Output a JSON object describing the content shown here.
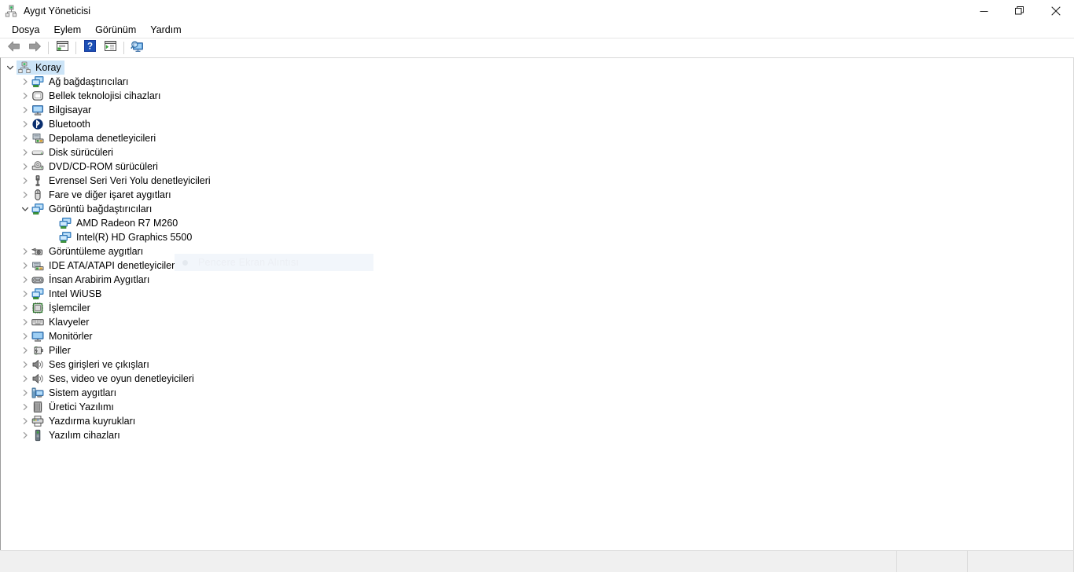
{
  "window": {
    "title": "Aygıt Yöneticisi",
    "icon": "device-manager-icon",
    "minimize_label": "—",
    "maximize_label": "❐",
    "close_label": "✕"
  },
  "menu": {
    "items": [
      {
        "label": "Dosya",
        "name": "menu-dosya"
      },
      {
        "label": "Eylem",
        "name": "menu-eylem"
      },
      {
        "label": "Görünüm",
        "name": "menu-gorunum"
      },
      {
        "label": "Yardım",
        "name": "menu-yardim"
      }
    ]
  },
  "toolbar": {
    "buttons": [
      {
        "name": "back-button",
        "icon": "back-arrow-icon"
      },
      {
        "name": "forward-button",
        "icon": "forward-arrow-icon"
      },
      {
        "name": "properties-button",
        "icon": "properties-window-icon"
      },
      {
        "name": "help-button",
        "icon": "help-question-icon"
      },
      {
        "name": "show-hidden-button",
        "icon": "window-play-icon"
      },
      {
        "name": "scan-hardware-button",
        "icon": "scan-monitor-icon"
      }
    ]
  },
  "tree": {
    "root": {
      "label": "Koray",
      "icon": "computer-root-icon",
      "expanded": true,
      "selected": true
    },
    "items": [
      {
        "label": "Ağ bağdaştırıcıları",
        "icon": "network-adapter-icon",
        "level": 1,
        "expanded": false
      },
      {
        "label": "Bellek teknolojisi cihazları",
        "icon": "memory-technology-icon",
        "level": 1,
        "expanded": false
      },
      {
        "label": "Bilgisayar",
        "icon": "computer-icon",
        "level": 1,
        "expanded": false
      },
      {
        "label": "Bluetooth",
        "icon": "bluetooth-icon",
        "level": 1,
        "expanded": false
      },
      {
        "label": "Depolama denetleyicileri",
        "icon": "storage-controller-icon",
        "level": 1,
        "expanded": false
      },
      {
        "label": "Disk sürücüleri",
        "icon": "disk-drive-icon",
        "level": 1,
        "expanded": false
      },
      {
        "label": "DVD/CD-ROM sürücüleri",
        "icon": "dvd-drive-icon",
        "level": 1,
        "expanded": false
      },
      {
        "label": "Evrensel Seri Veri Yolu denetleyicileri",
        "icon": "usb-controller-icon",
        "level": 1,
        "expanded": false
      },
      {
        "label": "Fare ve diğer işaret aygıtları",
        "icon": "mouse-icon",
        "level": 1,
        "expanded": false
      },
      {
        "label": "Görüntü bağdaştırıcıları",
        "icon": "display-adapter-icon",
        "level": 1,
        "expanded": true
      },
      {
        "label": "AMD Radeon R7 M260",
        "icon": "display-adapter-icon",
        "level": 2,
        "expanded": null
      },
      {
        "label": "Intel(R) HD Graphics 5500",
        "icon": "display-adapter-icon",
        "level": 2,
        "expanded": null
      },
      {
        "label": "Görüntüleme aygıtları",
        "icon": "imaging-device-icon",
        "level": 1,
        "expanded": false
      },
      {
        "label": "IDE ATA/ATAPI denetleyiciler",
        "icon": "ide-controller-icon",
        "level": 1,
        "expanded": false
      },
      {
        "label": "İnsan Arabirim Aygıtları",
        "icon": "human-interface-icon",
        "level": 1,
        "expanded": false
      },
      {
        "label": "Intel WiUSB",
        "icon": "network-adapter-icon",
        "level": 1,
        "expanded": false
      },
      {
        "label": "İşlemciler",
        "icon": "processor-icon",
        "level": 1,
        "expanded": false
      },
      {
        "label": "Klavyeler",
        "icon": "keyboard-icon",
        "level": 1,
        "expanded": false
      },
      {
        "label": "Monitörler",
        "icon": "monitor-icon",
        "level": 1,
        "expanded": false
      },
      {
        "label": "Piller",
        "icon": "battery-icon",
        "level": 1,
        "expanded": false
      },
      {
        "label": "Ses girişleri ve çıkışları",
        "icon": "audio-io-icon",
        "level": 1,
        "expanded": false
      },
      {
        "label": "Ses, video ve oyun denetleyicileri",
        "icon": "audio-io-icon",
        "level": 1,
        "expanded": false
      },
      {
        "label": "Sistem aygıtları",
        "icon": "system-device-icon",
        "level": 1,
        "expanded": false
      },
      {
        "label": "Üretici Yazılımı",
        "icon": "firmware-icon",
        "level": 1,
        "expanded": false
      },
      {
        "label": "Yazdırma kuyrukları",
        "icon": "print-queue-icon",
        "level": 1,
        "expanded": false
      },
      {
        "label": "Yazılım cihazları",
        "icon": "software-device-icon",
        "level": 1,
        "expanded": false
      }
    ]
  },
  "overlay": {
    "label": "Pencere Ekran Alıntısı",
    "icon": "record-dot-icon"
  },
  "colors": {
    "selection": "#cce4f7",
    "window_bg": "#ffffff",
    "statusbar_bg": "#f0f0f0",
    "text": "#000000"
  }
}
